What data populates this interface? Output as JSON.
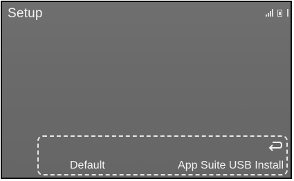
{
  "header": {
    "title": "Setup",
    "status_icons": [
      "signal-icon",
      "battery-icon",
      "bluetooth-icon"
    ]
  },
  "footer": {
    "back_icon": "return-arrow-icon",
    "buttons": [
      {
        "label": "Default"
      },
      {
        "label": "App Suite USB Install"
      }
    ]
  },
  "colors": {
    "background": "#6b6b6b",
    "text": "#f2f2f2",
    "border": "#111111"
  }
}
